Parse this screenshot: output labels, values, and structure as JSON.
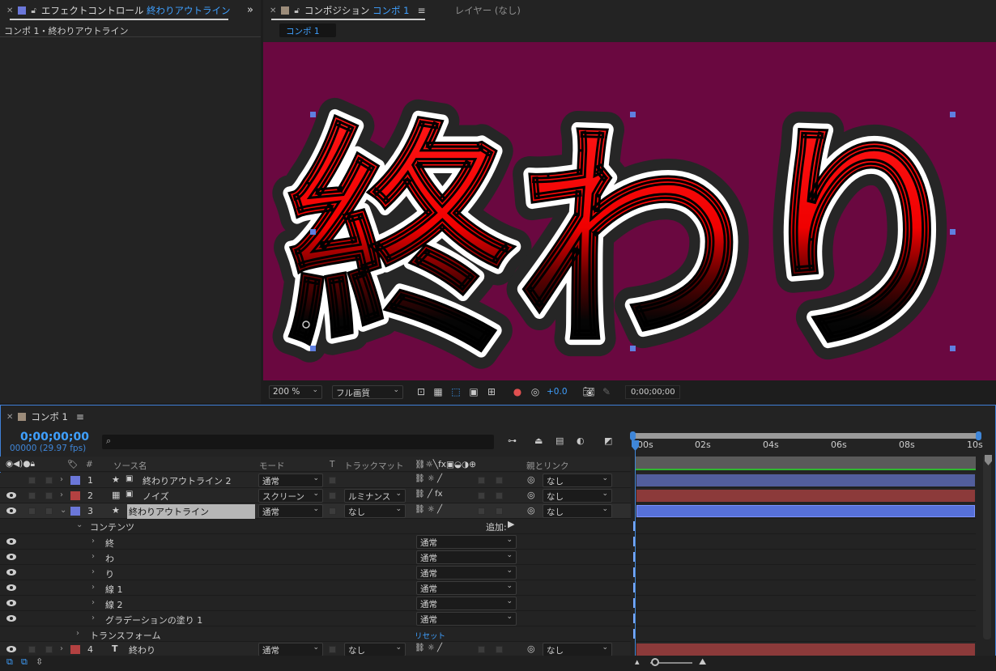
{
  "effect_panel": {
    "tab_label": "エフェクトコントロール",
    "tab_layer": "終わりアウトライン",
    "breadcrumb": "コンポ 1・終わりアウトライン",
    "menu_icon": "double-chevron-right-icon"
  },
  "comp_panel": {
    "tab_label": "コンポジション",
    "tab_comp": "コンポ 1",
    "layer_tab": "レイヤー (なし)",
    "sub_tab": "コンポ 1",
    "canvas_text": "終わり",
    "canvas_bg": "#6a0840",
    "fill_color": "#ff1010",
    "zoom": "200 %",
    "quality": "フル画質",
    "exposure": "+0.0",
    "timecode": "0;00;00;00"
  },
  "timeline": {
    "tab_label": "コンポ 1",
    "timecode": "0;00;00;00",
    "fps": "00000 (29.97 fps)",
    "search_placeholder": "",
    "col_number": "#",
    "col_source": "ソース名",
    "col_mode": "モード",
    "col_t": "T",
    "col_trackmatte": "トラックマット",
    "col_parent": "親とリンク",
    "ruler": [
      "00s",
      "02s",
      "04s",
      "06s",
      "08s",
      "10s"
    ],
    "layers": [
      {
        "num": "1",
        "name": "終わりアウトライン 2",
        "mode": "通常",
        "matte": "",
        "parent": "なし",
        "color": "#6b77d9",
        "bar": "#525e9c"
      },
      {
        "num": "2",
        "name": "ノイズ",
        "mode": "スクリーン",
        "matte": "ルミナンス",
        "parent": "なし",
        "color": "#b34141",
        "bar": "#8c3a3a"
      },
      {
        "num": "3",
        "name": "終わりアウトライン",
        "mode": "通常",
        "matte": "なし",
        "parent": "なし",
        "color": "#6b77d9",
        "bar": "#5670d8"
      },
      {
        "num": "4",
        "name": "終わり",
        "mode": "通常",
        "matte": "なし",
        "parent": "なし",
        "color": "#b34141",
        "bar": "#8c3a3a"
      }
    ],
    "contents_label": "コンテンツ",
    "add_label": "追加:",
    "contents": [
      {
        "name": "終",
        "mode": "通常"
      },
      {
        "name": "わ",
        "mode": "通常"
      },
      {
        "name": "り",
        "mode": "通常"
      },
      {
        "name": "線 1",
        "mode": "通常"
      },
      {
        "name": "線 2",
        "mode": "通常"
      },
      {
        "name": "グラデーションの塗り 1",
        "mode": "通常"
      }
    ],
    "transform_label": "トランスフォーム",
    "reset_label": "リセット"
  }
}
